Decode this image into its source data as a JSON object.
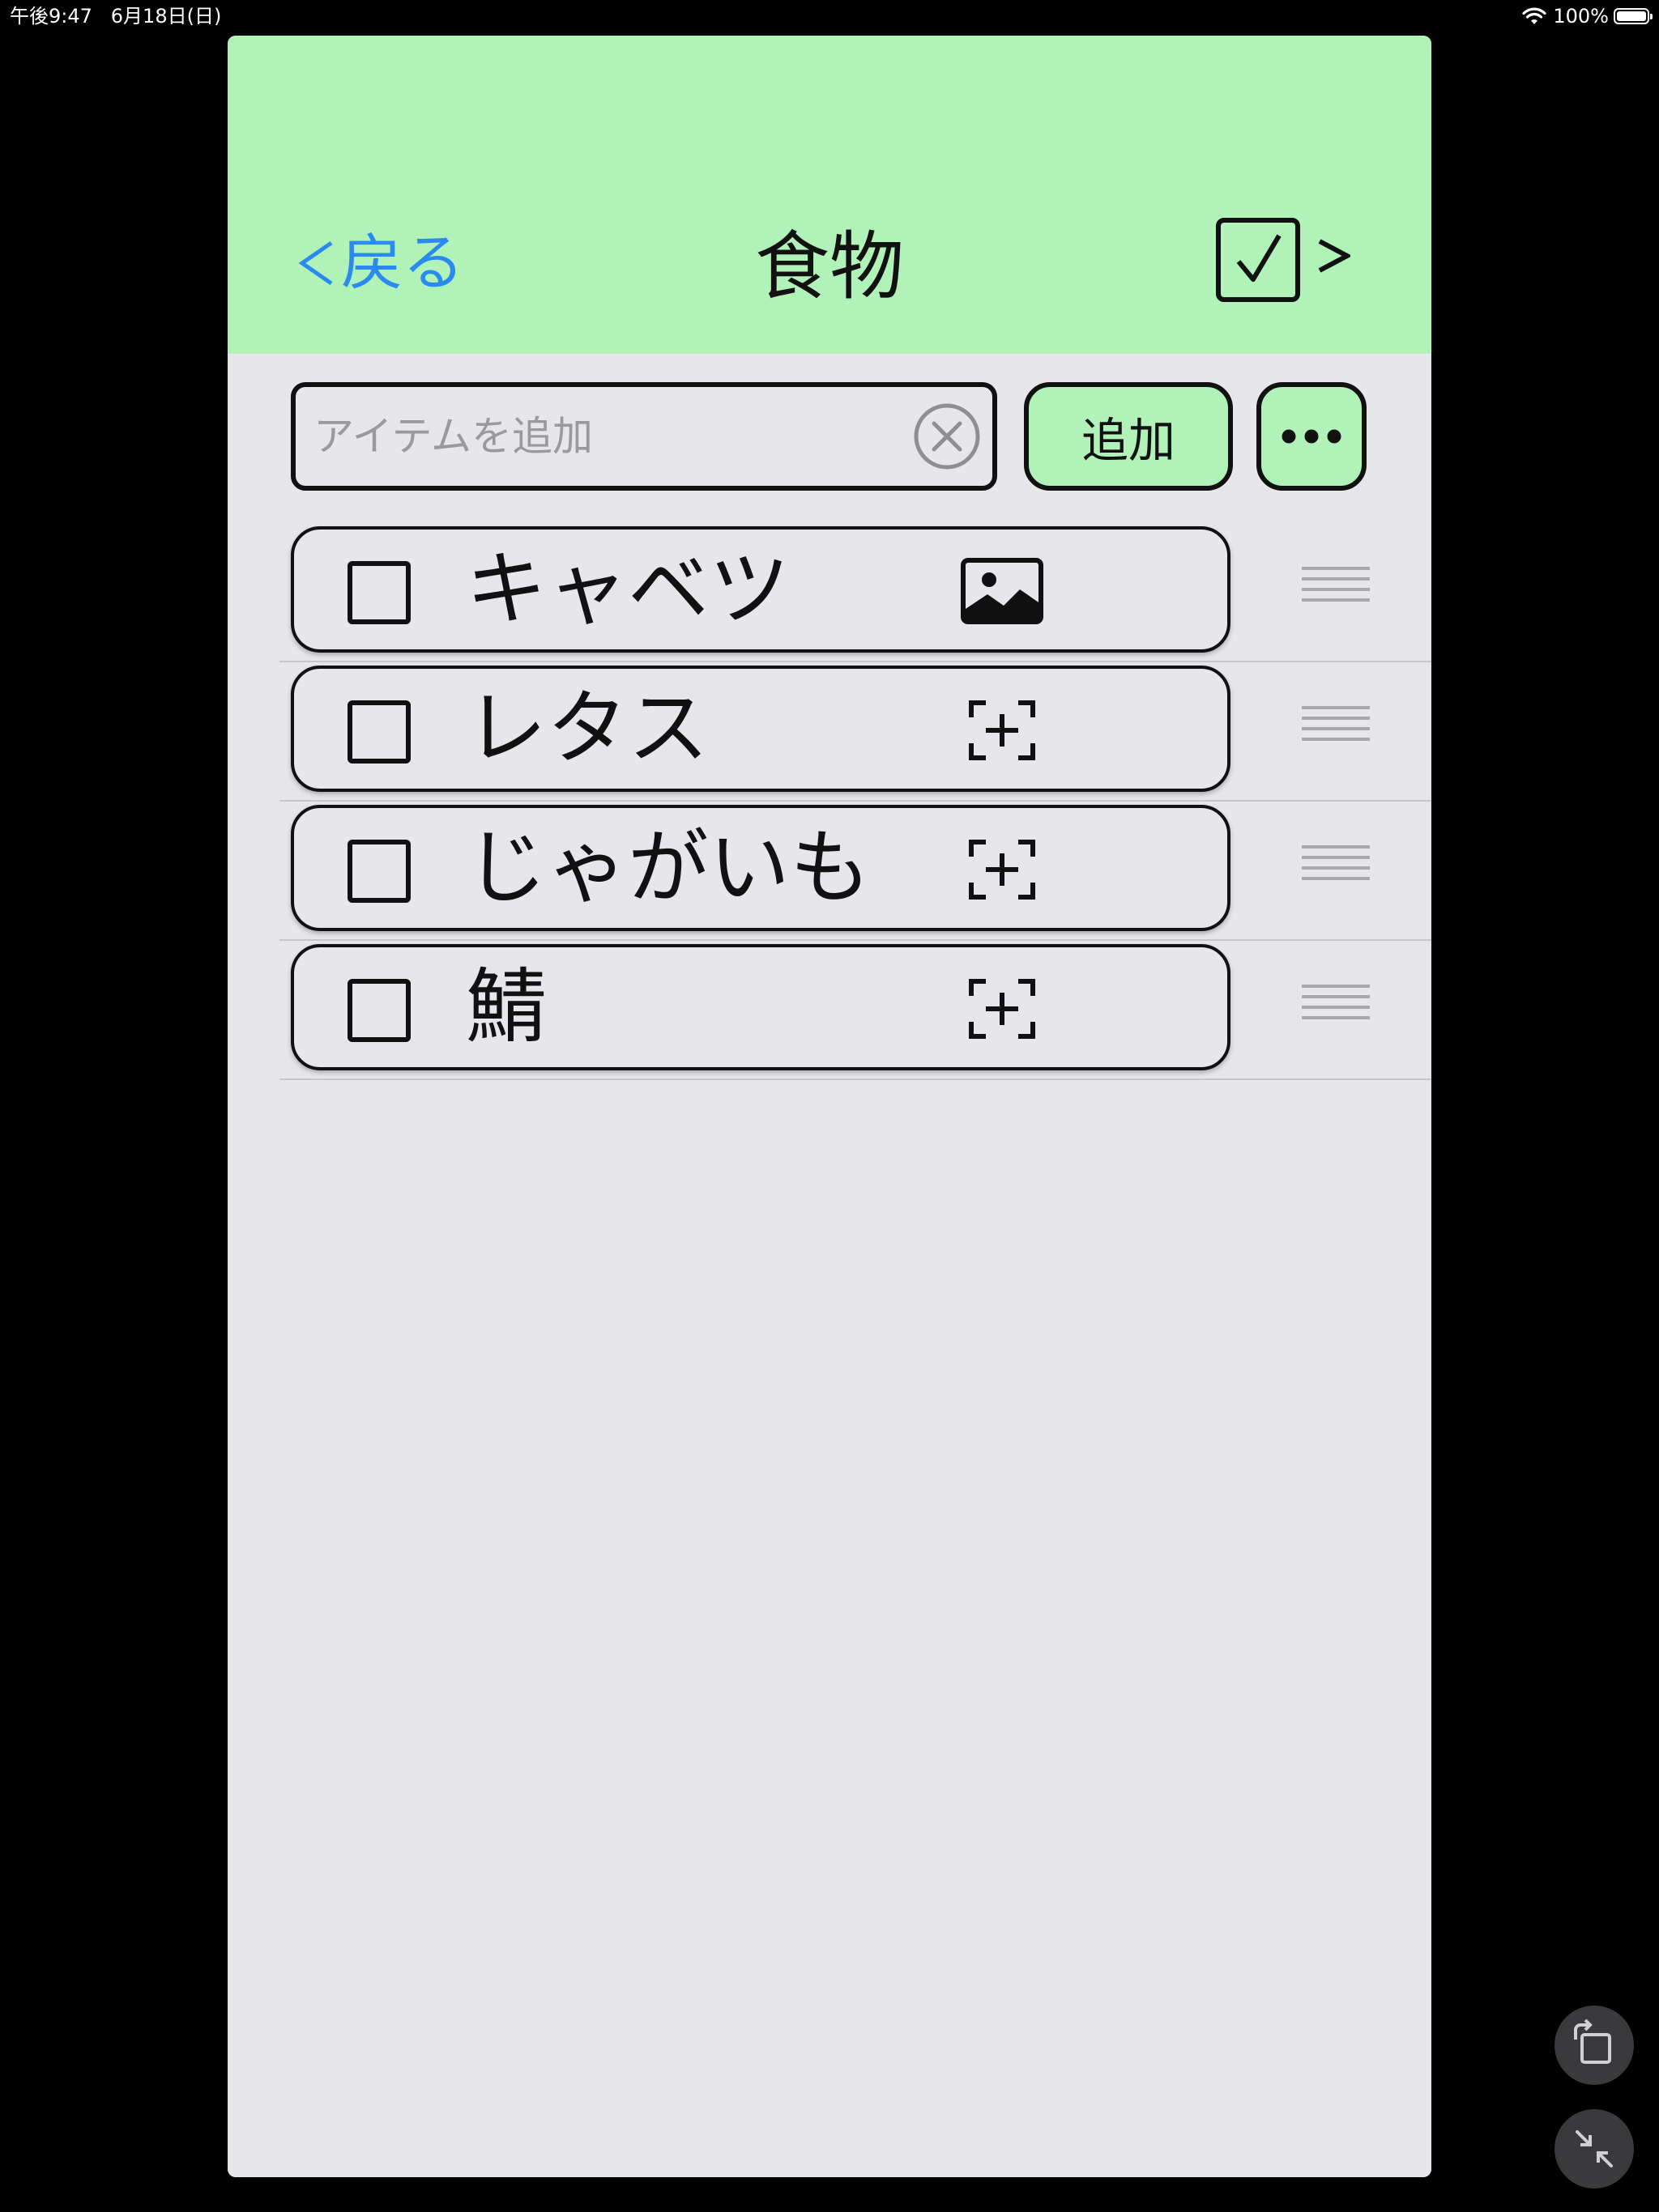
{
  "status_bar": {
    "time": "午後9:47   6月18日(日)",
    "battery": "100%",
    "battery_level": 1.0
  },
  "header": {
    "back_label": "戻る",
    "title": "食物",
    "background_color": "#b0f2b8",
    "back_color": "#2a8af0"
  },
  "add_bar": {
    "placeholder": "アイテムを追加",
    "value": "",
    "add_label": "追加"
  },
  "items": [
    {
      "name": "キャベツ",
      "checked": false,
      "photo_icon": "image-icon"
    },
    {
      "name": "レタス",
      "checked": false,
      "photo_icon": "add-photo-icon"
    },
    {
      "name": "じゃがいも",
      "checked": false,
      "photo_icon": "add-photo-icon"
    },
    {
      "name": "鯖",
      "checked": false,
      "photo_icon": "add-photo-icon"
    }
  ],
  "icons": {
    "back": "chevron-left-icon",
    "check_all": "checkbox-checked-icon",
    "next": "chevron-right-icon",
    "clear": "clear-circle-icon",
    "more": "ellipsis-icon",
    "drag": "drag-handle-icon",
    "rotate": "rotate-screen-icon",
    "collapse": "collapse-icon"
  }
}
